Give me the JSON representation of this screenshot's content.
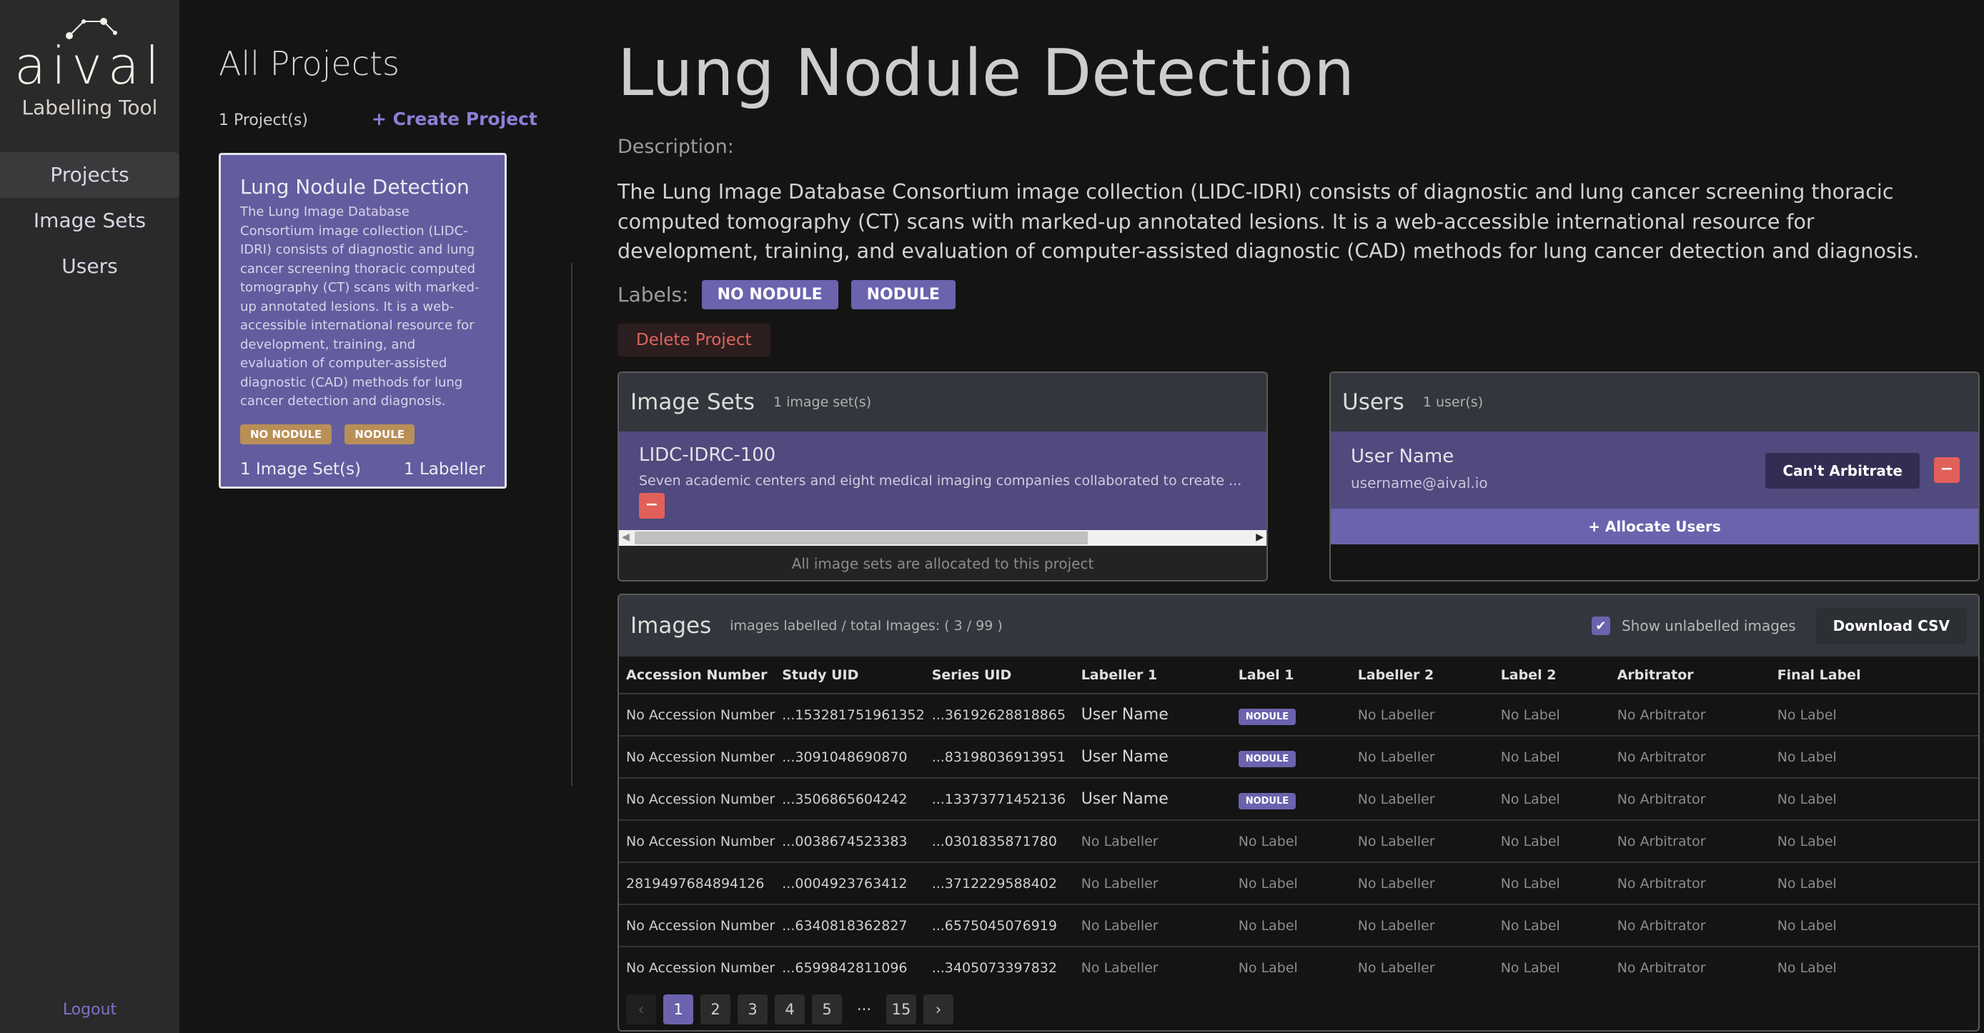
{
  "sidebar": {
    "logo_text": "aival",
    "subtitle": "Labelling Tool",
    "items": [
      {
        "label": "Projects",
        "active": true
      },
      {
        "label": "Image Sets",
        "active": false
      },
      {
        "label": "Users",
        "active": false
      }
    ],
    "logout": "Logout"
  },
  "projects": {
    "title": "All Projects",
    "count": "1 Project(s)",
    "create": "+ Create Project",
    "card": {
      "title": "Lung Nodule Detection",
      "description": "The Lung Image Database Consortium image collection (LIDC-IDRI) consists of diagnostic and lung cancer screening thoracic computed tomography (CT) scans with marked-up annotated lesions. It is a web-accessible international resource for development, training, and evaluation of computer-assisted diagnostic (CAD) methods for lung cancer detection and diagnosis.",
      "tags": [
        "NO NODULE",
        "NODULE"
      ],
      "image_sets": "1 Image Set(s)",
      "labellers": "1 Labeller"
    }
  },
  "detail": {
    "title": "Lung Nodule Detection",
    "description_label": "Description:",
    "description": "The Lung Image Database Consortium image collection (LIDC-IDRI) consists of diagnostic and lung cancer screening thoracic computed tomography (CT) scans with marked-up annotated lesions. It is a web-accessible international resource for development, training, and evaluation of computer-assisted diagnostic (CAD) methods for lung cancer detection and diagnosis.",
    "labels_label": "Labels:",
    "labels": [
      "NO NODULE",
      "NODULE"
    ],
    "delete": "Delete Project"
  },
  "image_sets": {
    "title": "Image Sets",
    "count": "1 image set(s)",
    "item": {
      "name": "LIDC-IDRC-100",
      "description": "Seven academic centers and eight medical imaging companies collaborated to create ..."
    },
    "remove_icon": "−",
    "footer": "All image sets are allocated to this project"
  },
  "users": {
    "title": "Users",
    "count": "1 user(s)",
    "item": {
      "name": "User Name",
      "email": "username@aival.io",
      "arbitrate": "Can't Arbitrate"
    },
    "remove_icon": "−",
    "allocate": "+ Allocate Users"
  },
  "images": {
    "title": "Images",
    "summary": "images labelled / total Images: ( 3 / 99 )",
    "show_unlabelled": "Show unlabelled images",
    "show_unlabelled_checked": true,
    "download": "Download CSV",
    "columns": [
      "Accession Number",
      "Study UID",
      "Series UID",
      "Labeller 1",
      "Label 1",
      "Labeller 2",
      "Label 2",
      "Arbitrator",
      "Final Label"
    ],
    "rows": [
      [
        "No Accession Number",
        "...153281751961352",
        "...36192628818865",
        "User Name",
        "NODULE",
        "No Labeller",
        "No Label",
        "No Arbitrator",
        "No Label"
      ],
      [
        "No Accession Number",
        "...3091048690870",
        "...83198036913951",
        "User Name",
        "NODULE",
        "No Labeller",
        "No Label",
        "No Arbitrator",
        "No Label"
      ],
      [
        "No Accession Number",
        "...3506865604242",
        "...13373771452136",
        "User Name",
        "NODULE",
        "No Labeller",
        "No Label",
        "No Arbitrator",
        "No Label"
      ],
      [
        "No Accession Number",
        "...0038674523383",
        "...0301835871780",
        "No Labeller",
        "No Label",
        "No Labeller",
        "No Label",
        "No Arbitrator",
        "No Label"
      ],
      [
        "2819497684894126",
        "...0004923763412",
        "...3712229588402",
        "No Labeller",
        "No Label",
        "No Labeller",
        "No Label",
        "No Arbitrator",
        "No Label"
      ],
      [
        "No Accession Number",
        "...6340818362827",
        "...6575045076919",
        "No Labeller",
        "No Label",
        "No Labeller",
        "No Label",
        "No Arbitrator",
        "No Label"
      ],
      [
        "No Accession Number",
        "...6599842811096",
        "...3405073397832",
        "No Labeller",
        "No Label",
        "No Labeller",
        "No Label",
        "No Arbitrator",
        "No Label"
      ]
    ],
    "pagination": {
      "prev": "‹",
      "pages": [
        "1",
        "2",
        "3",
        "4",
        "5"
      ],
      "ellipsis": "···",
      "last": "15",
      "next": "›",
      "current": "1"
    }
  },
  "colors": {
    "accent": "#6b63ae",
    "card_bg": "#635c9e",
    "tag_gold": "#b98f57",
    "danger": "#e2605a",
    "sidebar_bg": "#2a2a2a",
    "page_bg": "#141414"
  }
}
